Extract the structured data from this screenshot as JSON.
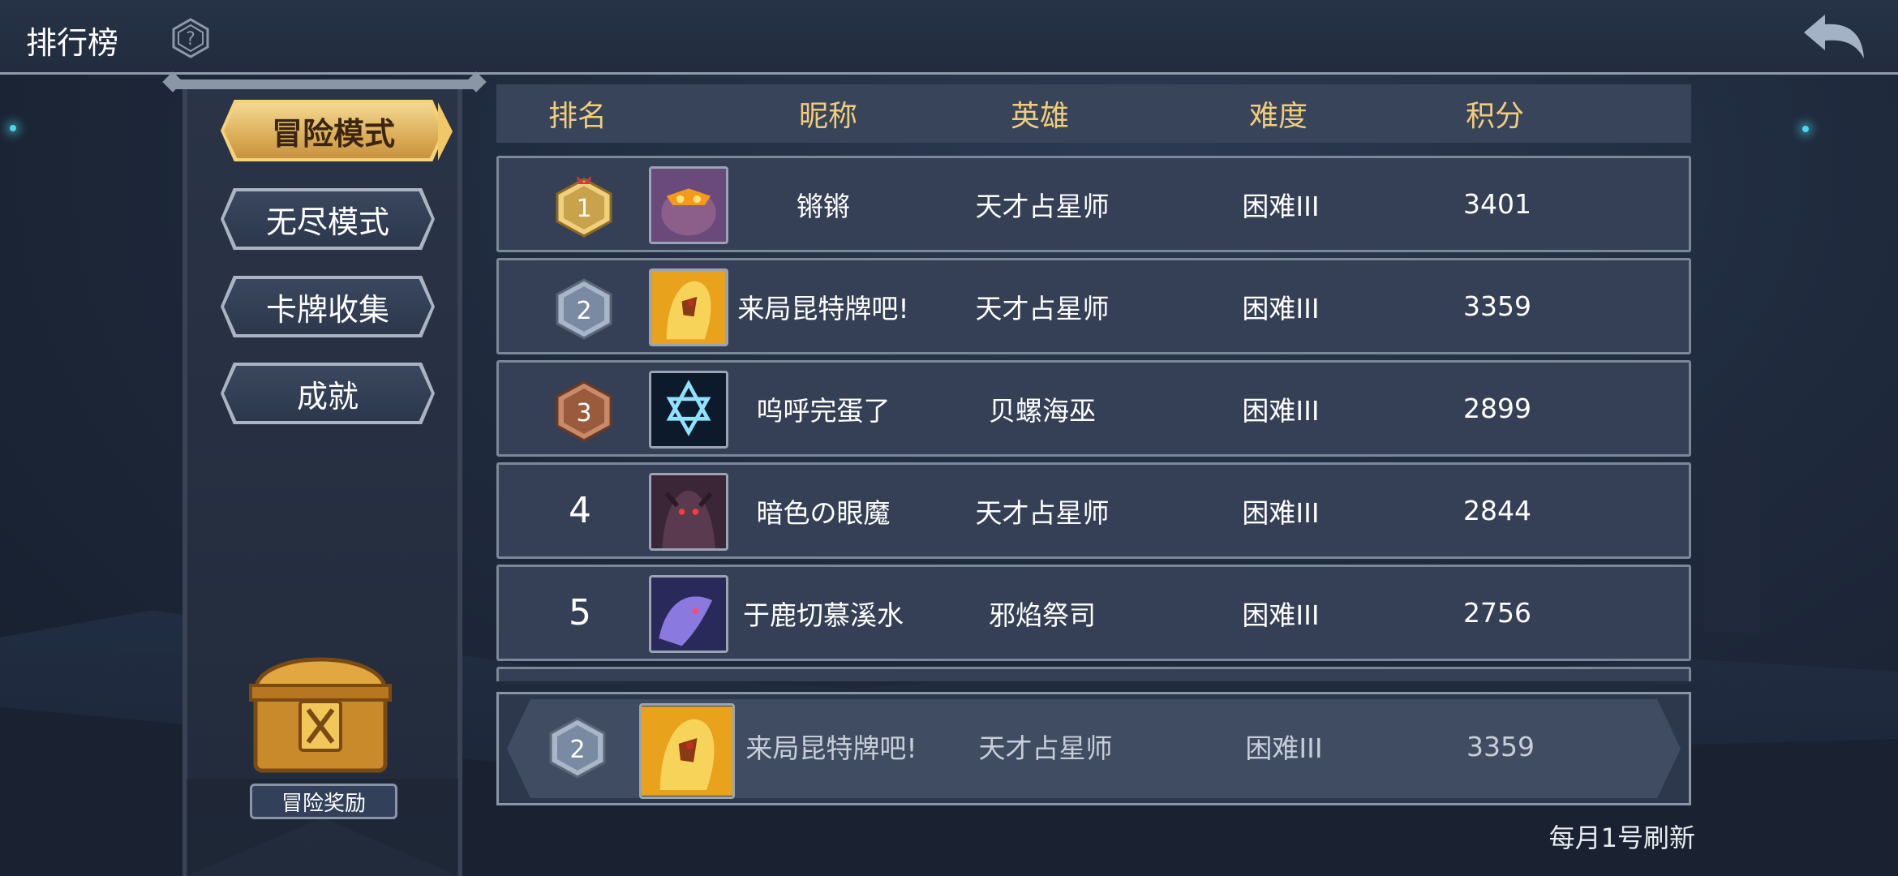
{
  "header": {
    "title": "排行榜",
    "help_icon": "question-shield-icon",
    "back_icon": "back-arrow-icon"
  },
  "modes": [
    {
      "label": "冒险模式",
      "active": true
    },
    {
      "label": "无尽模式",
      "active": false
    },
    {
      "label": "卡牌收集",
      "active": false
    },
    {
      "label": "成就",
      "active": false
    }
  ],
  "reward": {
    "label": "冒险奖励",
    "icon": "treasure-chest-icon"
  },
  "columns": {
    "rank": "排名",
    "nickname": "昵称",
    "hero": "英雄",
    "difficulty": "难度",
    "score": "积分"
  },
  "rows": [
    {
      "rank": "1",
      "nickname": "锵锵",
      "hero": "天才占星师",
      "difficulty": "困难III",
      "score": "3401",
      "avatar": "fire-demon-avatar"
    },
    {
      "rank": "2",
      "nickname": "来局昆特牌吧!",
      "hero": "天才占星师",
      "difficulty": "困难III",
      "score": "3359",
      "avatar": "golden-dragon-avatar"
    },
    {
      "rank": "3",
      "nickname": "呜呼完蛋了",
      "hero": "贝螺海巫",
      "difficulty": "困难III",
      "score": "2899",
      "avatar": "hexagram-avatar"
    },
    {
      "rank": "4",
      "nickname": "暗色の眼魔",
      "hero": "天才占星师",
      "difficulty": "困难III",
      "score": "2844",
      "avatar": "dark-demon-avatar"
    },
    {
      "rank": "5",
      "nickname": "于鹿切慕溪水",
      "hero": "邪焰祭司",
      "difficulty": "困难III",
      "score": "2756",
      "avatar": "purple-dragon-avatar"
    }
  ],
  "my_row": {
    "rank": "2",
    "nickname": "来局昆特牌吧!",
    "hero": "天才占星师",
    "difficulty": "困难III",
    "score": "3359",
    "avatar": "golden-dragon-avatar"
  },
  "footer": {
    "refresh_note": "每月1号刷新"
  },
  "colors": {
    "gold": "#f1cc7c",
    "silver": "#8e9fb8",
    "bronze": "#b9704e",
    "panel": "#354056"
  }
}
